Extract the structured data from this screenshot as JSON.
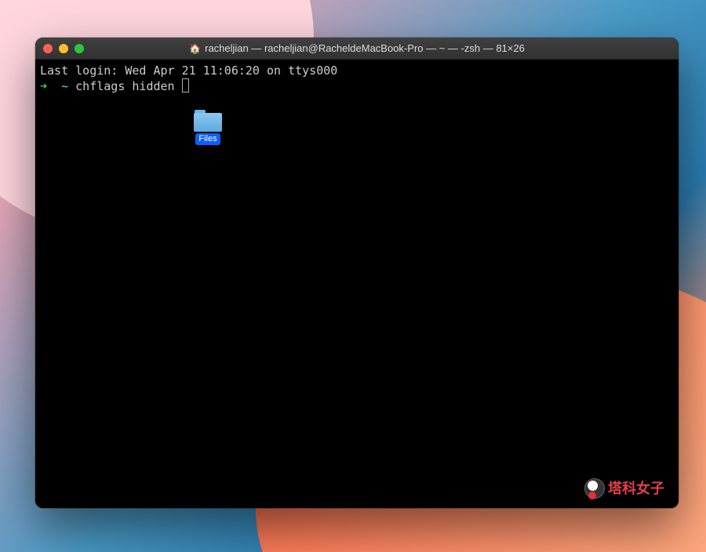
{
  "window": {
    "title": "racheljian — racheljian@RacheldeMacBook-Pro — ~ — -zsh — 81×26"
  },
  "terminal": {
    "last_login": "Last login: Wed Apr 21 11:06:20 on ttys000",
    "prompt_arrow": "➜",
    "prompt_cwd": "~",
    "command": "chflags hidden "
  },
  "drag": {
    "folder_name": "Files"
  },
  "watermark": {
    "text": "塔科女子"
  }
}
